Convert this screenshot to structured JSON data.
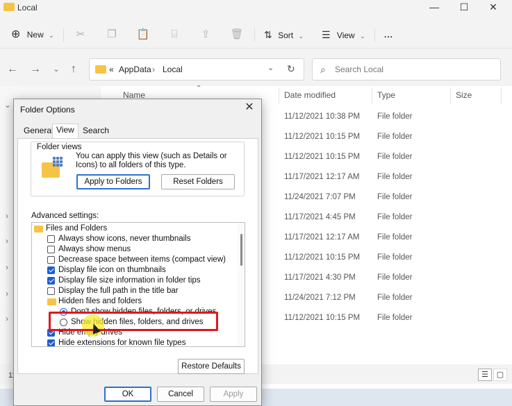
{
  "window": {
    "title": "Local"
  },
  "toolbar": {
    "new_label": "New",
    "sort_label": "Sort",
    "view_label": "View",
    "more_label": "..."
  },
  "address": {
    "prefix": "«",
    "segments": [
      "AppData",
      "Local"
    ]
  },
  "search": {
    "placeholder": "Search Local"
  },
  "columns": {
    "name": "Name",
    "date": "Date modified",
    "type": "Type",
    "size": "Size"
  },
  "rows": [
    {
      "date": "11/12/2021 10:38 PM",
      "type": "File folder"
    },
    {
      "date": "11/12/2021 10:15 PM",
      "type": "File folder"
    },
    {
      "date": "11/12/2021 10:15 PM",
      "type": "File folder"
    },
    {
      "date": "11/17/2021 12:17 AM",
      "type": "File folder"
    },
    {
      "date": "11/24/2021 7:07 PM",
      "type": "File folder"
    },
    {
      "date": "11/17/2021 4:45 PM",
      "type": "File folder"
    },
    {
      "date": "11/17/2021 12:17 AM",
      "type": "File folder"
    },
    {
      "date": "11/12/2021 10:15 PM",
      "type": "File folder"
    },
    {
      "date": "11/17/2021 4:30 PM",
      "type": "File folder"
    },
    {
      "date": "11/24/2021 7:12 PM",
      "type": "File folder"
    },
    {
      "date": "11/12/2021 10:15 PM",
      "type": "File folder"
    }
  ],
  "status": {
    "count": "11"
  },
  "dialog": {
    "title": "Folder Options",
    "tabs": [
      "General",
      "View",
      "Search"
    ],
    "folder_views_label": "Folder views",
    "folder_views_desc": "You can apply this view (such as Details or Icons) to all folders of this type.",
    "apply_button": "Apply to Folders",
    "reset_button": "Reset Folders",
    "advanced_label": "Advanced settings:",
    "settings": [
      {
        "kind": "folder",
        "label": "Files and Folders"
      },
      {
        "kind": "check",
        "checked": false,
        "label": "Always show icons, never thumbnails"
      },
      {
        "kind": "check",
        "checked": false,
        "label": "Always show menus"
      },
      {
        "kind": "check",
        "checked": false,
        "label": "Decrease space between items (compact view)"
      },
      {
        "kind": "check",
        "checked": true,
        "label": "Display file icon on thumbnails"
      },
      {
        "kind": "check",
        "checked": true,
        "label": "Display file size information in folder tips"
      },
      {
        "kind": "check",
        "checked": false,
        "label": "Display the full path in the title bar"
      },
      {
        "kind": "folder",
        "label": "Hidden files and folders"
      },
      {
        "kind": "radio",
        "checked": true,
        "label": "Don't show hidden files, folders, or drives"
      },
      {
        "kind": "radio",
        "checked": false,
        "label": "Show hidden files, folders, and drives"
      },
      {
        "kind": "check",
        "checked": true,
        "label": "Hide empty drives"
      },
      {
        "kind": "check",
        "checked": true,
        "label": "Hide extensions for known file types"
      }
    ],
    "restore_button": "Restore Defaults",
    "ok_button": "OK",
    "cancel_button": "Cancel",
    "apply_footer_button": "Apply"
  }
}
